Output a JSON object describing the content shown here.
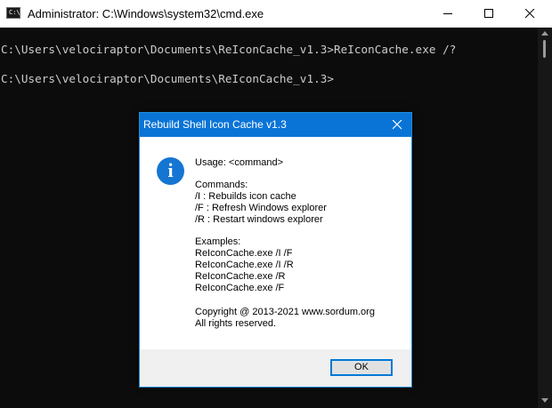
{
  "window": {
    "title": "Administrator: C:\\Windows\\system32\\cmd.exe",
    "icon_text": "C:\\."
  },
  "console": {
    "lines": [
      "C:\\Users\\velociraptor\\Documents\\ReIconCache_v1.3>ReIconCache.exe /?",
      "C:\\Users\\velociraptor\\Documents\\ReIconCache_v1.3>"
    ]
  },
  "dialog": {
    "title": "Rebuild Shell Icon Cache v1.3",
    "icon_glyph": "i",
    "usage": "Usage: <command>",
    "commands_header": "Commands:",
    "commands": [
      "/I : Rebuilds icon cache",
      "/F : Refresh Windows explorer",
      "/R : Restart windows explorer"
    ],
    "examples_header": "Examples:",
    "examples": [
      "ReIconCache.exe /I /F",
      "ReIconCache.exe /I /R",
      "ReIconCache.exe /R",
      "ReIconCache.exe /F"
    ],
    "copyright": "Copyright @ 2013-2021 www.sordum.org",
    "rights": "All rights reserved.",
    "ok_label": "OK"
  },
  "colors": {
    "console_bg": "#0c0c0c",
    "console_text": "#cccccc",
    "dialog_titlebar": "#0a74d6",
    "info_icon": "#1575d2",
    "ok_border": "#0078d7"
  },
  "icons": [
    "cmd-app-icon",
    "minimize-icon",
    "maximize-icon",
    "close-icon",
    "info-icon",
    "scroll-up-arrow",
    "scroll-down-arrow"
  ]
}
